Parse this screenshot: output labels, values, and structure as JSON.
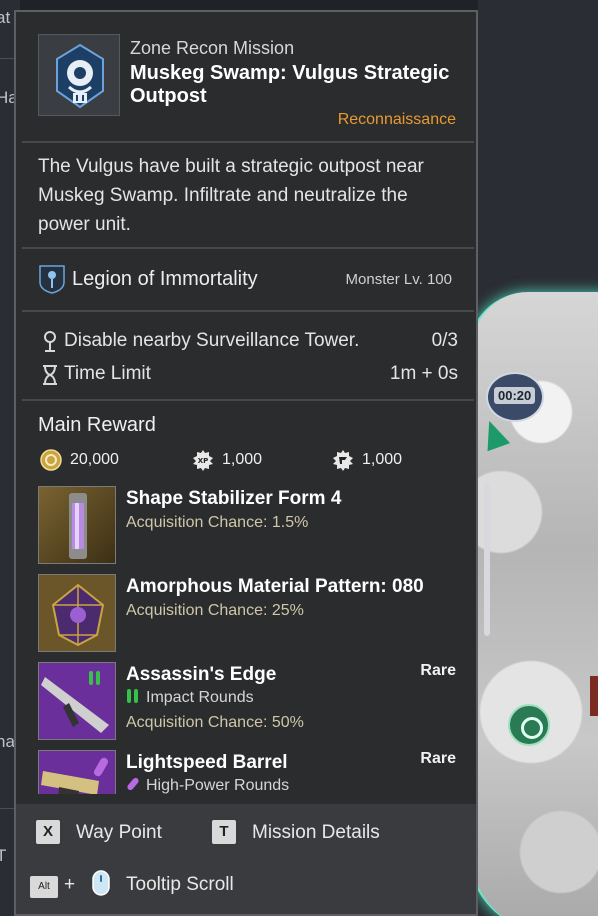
{
  "background": {
    "left_edge_tags": [
      "at",
      "Ha",
      "na",
      "T"
    ],
    "map_timer": "00:20"
  },
  "tooltip": {
    "mission_type": "Zone Recon Mission",
    "title": "Muskeg Swamp: Vulgus Strategic Outpost",
    "category": "Reconnaissance",
    "description": "The Vulgus have built a strategic outpost near Muskeg Swamp. Infiltrate and neutralize the power unit.",
    "faction": "Legion of Immortality",
    "monster_level": "Monster Lv. 100",
    "objectives": [
      {
        "icon": "surveillance-tower-icon",
        "label": "Disable nearby Surveillance Tower.",
        "value": "0/3"
      },
      {
        "icon": "hourglass-icon",
        "label": "Time Limit",
        "value": "1m + 0s"
      }
    ],
    "reward_heading": "Main Reward",
    "currencies": [
      {
        "icon": "gold-coin-icon",
        "value": "20,000"
      },
      {
        "icon": "xp-icon",
        "value": "1,000"
      },
      {
        "icon": "mastery-icon",
        "value": "1,000"
      }
    ],
    "items": [
      {
        "name": "Shape Stabilizer Form 4",
        "chance": "Acquisition Chance: 1.5%",
        "rarity": "",
        "ammo": ""
      },
      {
        "name": "Amorphous Material Pattern: 080",
        "chance": "Acquisition Chance: 25%",
        "rarity": "",
        "ammo": ""
      },
      {
        "name": "Assassin's Edge",
        "chance": "Acquisition Chance: 50%",
        "rarity": "Rare",
        "ammo": "Impact Rounds"
      },
      {
        "name": "Lightspeed Barrel",
        "chance": "",
        "rarity": "Rare",
        "ammo": "High-Power Rounds"
      }
    ],
    "footer": {
      "waypoint_key": "X",
      "waypoint_label": "Way Point",
      "details_key": "T",
      "details_label": "Mission Details",
      "alt_key": "Alt",
      "plus": "+",
      "scroll_label": "Tooltip Scroll"
    }
  },
  "colors": {
    "category": "#e99a2f",
    "map_glow": "#4fd0b5",
    "impact_ammo": "#35c14a",
    "highpower_ammo": "#b86be0"
  }
}
